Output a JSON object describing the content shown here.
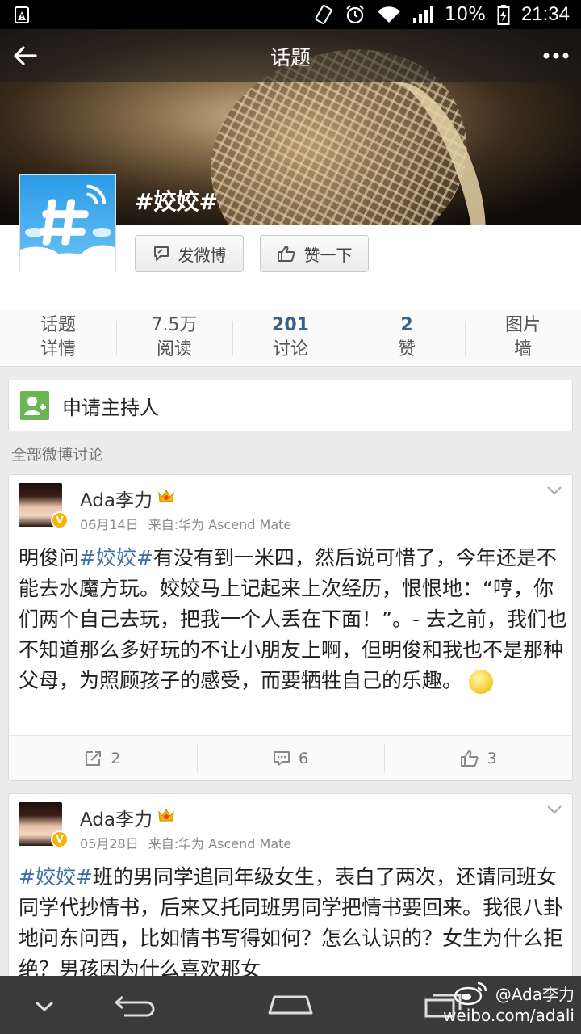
{
  "status_bar": {
    "battery": "10%",
    "time": "21:34",
    "icons": [
      "alert-icon",
      "vibrate-icon",
      "alarm-icon",
      "wifi-icon",
      "signal-icon",
      "battery-icon"
    ]
  },
  "topbar": {
    "title": "话题",
    "back_icon": "back-arrow-icon",
    "more_icon": "more-dots-icon"
  },
  "topic": {
    "name": "#姣姣#",
    "post_label": "发微博",
    "like_label": "赞一下"
  },
  "stats": [
    {
      "value": "话题",
      "label": "详情"
    },
    {
      "value": "7.5万",
      "label": "阅读"
    },
    {
      "value": "201",
      "label": "讨论"
    },
    {
      "value": "2",
      "label": "赞"
    },
    {
      "value": "图片",
      "label": "墙"
    }
  ],
  "apply_host": "申请主持人",
  "section_title": "全部微博讨论",
  "posts": [
    {
      "author": "Ada李力",
      "date": "06月14日",
      "source": "来自:华为 Ascend Mate",
      "tag": "#姣姣#",
      "text_before": "明俊问",
      "text_after": "有没有到一米四，然后说可惜了，今年还是不能去水魔方玩。姣姣马上记起来上次经历，恨恨地：“哼，你们两个自己去玩，把我一个人丢在下面！”。- 去之前，我们也不知道那么多好玩的不让小朋友上啊，但明俊和我也不是那种父母，为照顾孩子的感受，而要牺牲自己的乐趣。",
      "reposts": "2",
      "comments": "6",
      "likes": "3"
    },
    {
      "author": "Ada李力",
      "date": "05月28日",
      "source": "来自:华为 Ascend Mate",
      "tag": "#姣姣#",
      "text_before": "",
      "text_after": "班的男同学追同年级女生，表白了两次，还请同班女同学代抄情书，后来又托同班男同学把情书要回来。我很八卦地问东问西，比如情书写得如何？怎么认识的？女生为什么拒绝？男孩因为什么喜欢那女"
    }
  ],
  "watermark": {
    "line1": "@Ada李力",
    "line2": "weibo.com/adali"
  },
  "colors": {
    "tag_blue": "#3f6ea8",
    "stat_blue": "#3a5f8a",
    "vip_gold": "#f5b400"
  }
}
